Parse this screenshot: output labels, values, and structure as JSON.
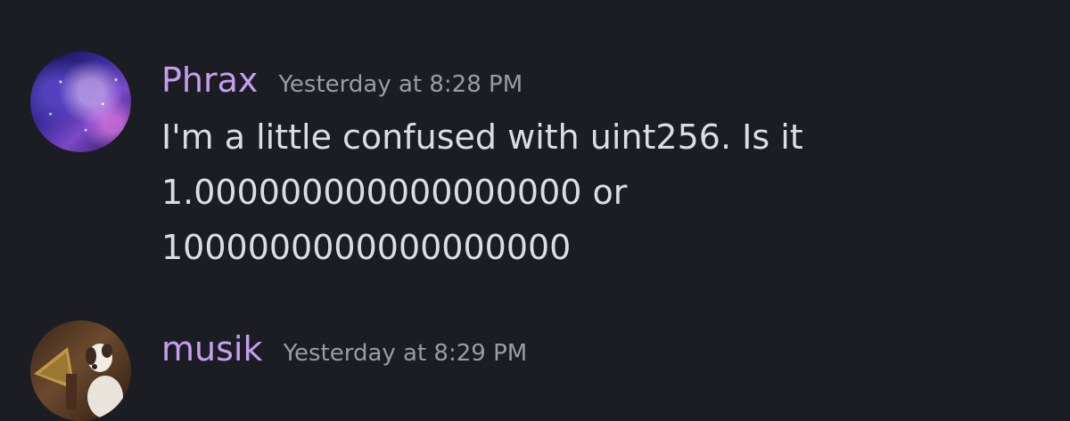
{
  "messages": [
    {
      "author": "Phrax",
      "timestamp": "Yesterday at 8:28 PM",
      "lines": [
        "I'm a little confused with uint256. Is it",
        "1.000000000000000000 or",
        "1000000000000000000"
      ],
      "author_color": "#c49ff0"
    },
    {
      "author": "musik",
      "timestamp": "Yesterday at 8:29 PM",
      "author_color": "#c49ff0"
    }
  ],
  "colors": {
    "background": "#1c1d22",
    "text": "#dcdde2",
    "timestamp": "#9a9ca5"
  }
}
